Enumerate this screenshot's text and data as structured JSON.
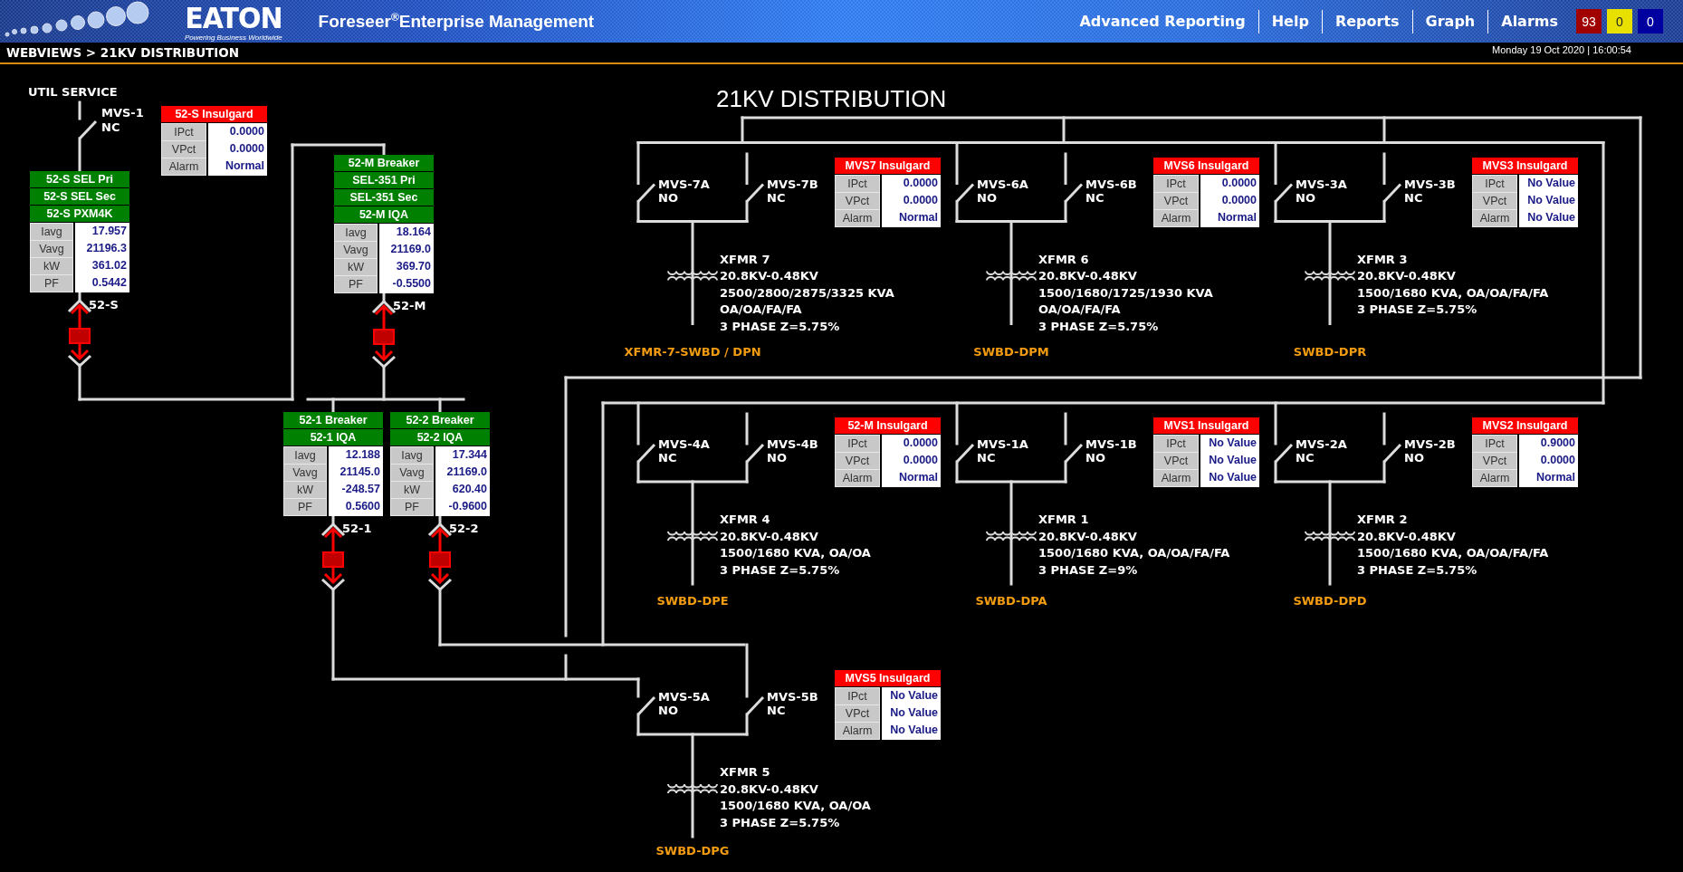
{
  "header": {
    "logo": "EATON",
    "tagline": "Powering Business Worldwide",
    "app_title": "Foreseer$^{®}$Enterprise Management",
    "nav": [
      "Advanced Reporting",
      "Help",
      "Reports",
      "Graph",
      "Alarms"
    ],
    "alarm_counts": [
      {
        "count": "93",
        "color": "#a00000"
      },
      {
        "count": "0",
        "color": "#e8e000"
      },
      {
        "count": "0",
        "color": "#0000a0"
      }
    ]
  },
  "breadcrumb": "WEBVIEWS > 21KV DISTRIBUTION",
  "datetime": "Monday 19 Oct 2020 | 16:00:54",
  "diagram": {
    "title": "21KV DISTRIBUTION",
    "source_label": "UTIL SERVICE",
    "main_switch": {
      "name": "MVS-1",
      "state": "NC"
    },
    "insulgard": {
      "title": "52-S Insulgard",
      "readings": [
        {
          "label": "IPct",
          "value": "0.0000"
        },
        {
          "label": "VPct",
          "value": "0.0000"
        },
        {
          "label": "Alarm",
          "value": "Normal"
        }
      ]
    },
    "meters": [
      {
        "titles": [
          "52-S SEL Pri",
          "52-S SEL Sec",
          "52-S PXM4K"
        ],
        "readings": [
          {
            "label": "Iavg",
            "value": "17.957"
          },
          {
            "label": "Vavg",
            "value": "21196.3"
          },
          {
            "label": "kW",
            "value": "361.02"
          },
          {
            "label": "PF",
            "value": "0.5442"
          }
        ],
        "breaker": "52-S"
      },
      {
        "titles": [
          "52-M Breaker",
          "SEL-351 Pri",
          "SEL-351 Sec",
          "52-M IQA"
        ],
        "readings": [
          {
            "label": "Iavg",
            "value": "18.164"
          },
          {
            "label": "Vavg",
            "value": "21169.0"
          },
          {
            "label": "kW",
            "value": "369.70"
          },
          {
            "label": "PF",
            "value": "-0.5500"
          }
        ],
        "breaker": "52-M"
      },
      {
        "titles": [
          "52-1 Breaker",
          "52-1 IQA"
        ],
        "readings": [
          {
            "label": "Iavg",
            "value": "12.188"
          },
          {
            "label": "Vavg",
            "value": "21145.0"
          },
          {
            "label": "kW",
            "value": "-248.57"
          },
          {
            "label": "PF",
            "value": "0.5600"
          }
        ],
        "breaker": "52-1"
      },
      {
        "titles": [
          "52-2 Breaker",
          "52-2 IQA"
        ],
        "readings": [
          {
            "label": "Iavg",
            "value": "17.344"
          },
          {
            "label": "Vavg",
            "value": "21169.0"
          },
          {
            "label": "kW",
            "value": "620.40"
          },
          {
            "label": "PF",
            "value": "-0.9600"
          }
        ],
        "breaker": "52-2"
      }
    ],
    "switch_groups": [
      {
        "switches": [
          {
            "name": "MVS-7A",
            "state": "NO"
          },
          {
            "name": "MVS-7B",
            "state": "NC"
          }
        ],
        "insulgard": {
          "title": "MVS7 Insulgard",
          "readings": [
            {
              "label": "IPct",
              "value": "0.0000"
            },
            {
              "label": "VPct",
              "value": "0.0000"
            },
            {
              "label": "Alarm",
              "value": "Normal"
            }
          ]
        },
        "transformer": [
          "XFMR 7",
          "20.8KV-0.48KV",
          "2500/2800/2875/3325 KVA",
          "OA/OA/FA/FA",
          "3 PHASE Z=5.75%"
        ],
        "feeder": "XFMR-7-SWBD / DPN"
      },
      {
        "switches": [
          {
            "name": "MVS-6A",
            "state": "NO"
          },
          {
            "name": "MVS-6B",
            "state": "NC"
          }
        ],
        "insulgard": {
          "title": "MVS6 Insulgard",
          "readings": [
            {
              "label": "IPct",
              "value": "0.0000"
            },
            {
              "label": "VPct",
              "value": "0.0000"
            },
            {
              "label": "Alarm",
              "value": "Normal"
            }
          ]
        },
        "transformer": [
          "XFMR 6",
          "20.8KV-0.48KV",
          "1500/1680/1725/1930 KVA",
          "OA/OA/FA/FA",
          "3 PHASE Z=5.75%"
        ],
        "feeder": "SWBD-DPM"
      },
      {
        "switches": [
          {
            "name": "MVS-3A",
            "state": "NO"
          },
          {
            "name": "MVS-3B",
            "state": "NC"
          }
        ],
        "insulgard": {
          "title": "MVS3 Insulgard",
          "readings": [
            {
              "label": "IPct",
              "value": "No Value"
            },
            {
              "label": "VPct",
              "value": "No Value"
            },
            {
              "label": "Alarm",
              "value": "No Value"
            }
          ]
        },
        "transformer": [
          "XFMR 3",
          "20.8KV-0.48KV",
          "1500/1680 KVA, OA/OA/FA/FA",
          "3 PHASE Z=5.75%"
        ],
        "feeder": "SWBD-DPR"
      },
      {
        "switches": [
          {
            "name": "MVS-4A",
            "state": "NC"
          },
          {
            "name": "MVS-4B",
            "state": "NO"
          }
        ],
        "insulgard": {
          "title": "52-M Insulgard",
          "readings": [
            {
              "label": "IPct",
              "value": "0.0000"
            },
            {
              "label": "VPct",
              "value": "0.0000"
            },
            {
              "label": "Alarm",
              "value": "Normal"
            }
          ]
        },
        "transformer": [
          "XFMR 4",
          "20.8KV-0.48KV",
          "1500/1680 KVA, OA/OA",
          "3 PHASE Z=5.75%"
        ],
        "feeder": "SWBD-DPE"
      },
      {
        "switches": [
          {
            "name": "MVS-1A",
            "state": "NC"
          },
          {
            "name": "MVS-1B",
            "state": "NO"
          }
        ],
        "insulgard": {
          "title": "MVS1 Insulgard",
          "readings": [
            {
              "label": "IPct",
              "value": "No Value"
            },
            {
              "label": "VPct",
              "value": "No Value"
            },
            {
              "label": "Alarm",
              "value": "No Value"
            }
          ]
        },
        "transformer": [
          "XFMR 1",
          "20.8KV-0.48KV",
          "1500/1680 KVA, OA/OA/FA/FA",
          "3 PHASE Z=9%"
        ],
        "feeder": "SWBD-DPA"
      },
      {
        "switches": [
          {
            "name": "MVS-2A",
            "state": "NC"
          },
          {
            "name": "MVS-2B",
            "state": "NO"
          }
        ],
        "insulgard": {
          "title": "MVS2 Insulgard",
          "readings": [
            {
              "label": "IPct",
              "value": "0.9000"
            },
            {
              "label": "VPct",
              "value": "0.0000"
            },
            {
              "label": "Alarm",
              "value": "Normal"
            }
          ]
        },
        "transformer": [
          "XFMR 2",
          "20.8KV-0.48KV",
          "1500/1680 KVA, OA/OA/FA/FA",
          "3 PHASE Z=5.75%"
        ],
        "feeder": "SWBD-DPD"
      },
      {
        "switches": [
          {
            "name": "MVS-5A",
            "state": "NO"
          },
          {
            "name": "MVS-5B",
            "state": "NC"
          }
        ],
        "insulgard": {
          "title": "MVS5 Insulgard",
          "readings": [
            {
              "label": "IPct",
              "value": "No Value"
            },
            {
              "label": "VPct",
              "value": "No Value"
            },
            {
              "label": "Alarm",
              "value": "No Value"
            }
          ]
        },
        "transformer": [
          "XFMR 5",
          "20.8KV-0.48KV",
          "1500/1680 KVA, OA/OA",
          "3 PHASE Z=5.75%"
        ],
        "feeder": "SWBD-DPG"
      }
    ]
  }
}
